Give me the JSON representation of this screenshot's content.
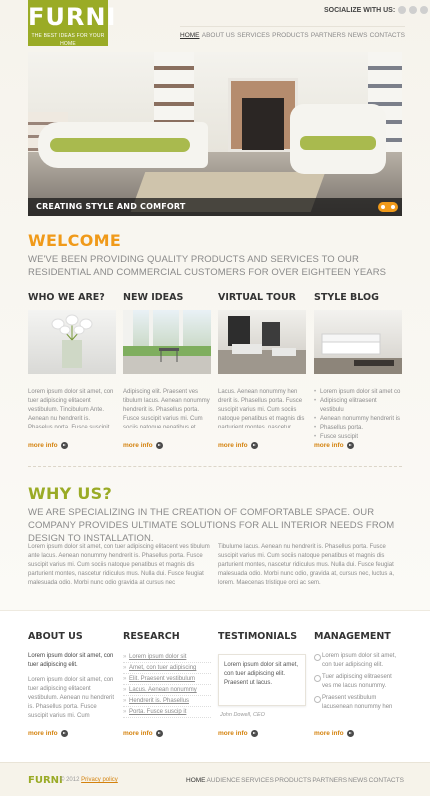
{
  "header": {
    "logo_title": "FURNI",
    "logo_tagline": "THE BEST IDEAS FOR YOUR HOME",
    "social_label": "SOCIALIZE WITH US:",
    "social_icons": [
      "twitter-icon",
      "facebook-icon",
      "rss-icon"
    ],
    "nav": [
      "HOME",
      "ABOUT US",
      "SERVICES",
      "PRODUCTS",
      "PARTNERS",
      "NEWS",
      "CONTACTS"
    ],
    "nav_active_index": 0
  },
  "hero": {
    "caption": "CREATING STYLE AND COMFORT"
  },
  "welcome": {
    "title": "WELCOME",
    "lead": "WE'VE BEEN PROVIDING QUALITY PRODUCTS AND SERVICES TO OUR RESIDENTIAL AND COMMERCIAL CUSTOMERS FOR OVER EIGHTEEN YEARS",
    "columns": [
      {
        "title": "WHO WE ARE?",
        "text": "Lorem ipsum dolor sit amet, con tuer adipiscing elitacent vestibulum. Tincibulum Ante. Aenean nu hendrerit is. Phaselus porta. Fusce suscipit varius mi. Cum",
        "more": "more info"
      },
      {
        "title": "NEW IDEAS",
        "text": "Adipiscing elit. Praesent ves tibulum lacus. Aenean nonummy hendrerit is. Phasellus porta. Fusce suscipit varius mi. Cum sociis natoque penatibus et",
        "more": "more info"
      },
      {
        "title": "VIRTUAL TOUR",
        "text": "Lacus. Aenean nonummy hen drerit is. Phasellus porta. Fusce suscipit varius mi. Cum sociis natoque penatibus et magnis dis parturient montes, nascetur",
        "more": "more info"
      },
      {
        "title": "STYLE BLOG",
        "bullets": [
          "Lorem ipsum dolor sit amet co",
          "Adipiscing elitraesent vestibulu",
          "Aenean nonummy hendrerit is",
          "Phasellus porta.",
          "Fusce suscipit"
        ],
        "more": "more info"
      }
    ]
  },
  "whyus": {
    "title": "WHY US?",
    "lead": "WE ARE SPECIALIZING IN THE CREATION OF COMFORTABLE SPACE. OUR COMPANY PROVIDES ULTIMATE SOLUTIONS FOR ALL INTERIOR NEEDS FROM DESIGN TO INSTALLATION.",
    "para_left": "Lorem ipsum dolor sit amet, con tuer adipiscing elitacent ves tibulum ante lacus. Aenean nonummy hendrerit is. Phasellus porta. Fusce suscipit varius mi. Cum sociis natoque penatibus et magnis dis parturient montes, nascetur ridiculus mus. Nulla dui. Fusce feugiat malesuada odio. Morbi nunc odio gravida at cursus nec",
    "para_right": "Tibulume lacus. Aenean nu hendrerit is. Phasellus porta. Fusce suscipit varius mi. Cum sociis natoque penatibus et magnis dis parturient montes, nascetur ridiculus mus. Nulla dui. Fusce feugiat malesuada odio. Morbi nunc odio, gravida at, cursus nec, luctus a, lorem. Maecenas tristique orci ac sem."
  },
  "widgets": {
    "about": {
      "title": "ABOUT US",
      "intro": "Lorem ipsum dolor sit amet, con tuer adipiscing elit.",
      "text": "Lorem ipsum dolor sit amet, con tuer adipiscing elitacent vestibulum. Aenean nu hendrerit is. Phasellus porta. Fusce suscipit varius mi. Cum",
      "more": "more info"
    },
    "research": {
      "title": "RESEARCH",
      "links": [
        "Lorem ipsum dolor sit",
        "Amet, con tuer adipiscing",
        "Elit. Praesent vestibulum",
        "Lacus. Aenean nonummy",
        "Hendrerit is. Phasellus",
        "Porta. Fusce suscip it"
      ],
      "more": "more info"
    },
    "testimonials": {
      "title": "TESTIMONIALS",
      "quote": "Lorem ipsum dolor sit amet, con tuer adipiscing elit. Praesent ut lacus.",
      "author": "John Dowell, CEO",
      "more": "more info"
    },
    "management": {
      "title": "MANAGEMENT",
      "items": [
        "Lorem ipsum dolor sit amet, con tuer adipiscing elit.",
        "Tuer adipiscing elitraesent ves me lacus nonummy.",
        "Praesent vestibulum lacusenean nonummy hen"
      ],
      "more": "more info"
    }
  },
  "footer": {
    "logo": "FURNI",
    "copyright": "© 2012",
    "privacy": "Privacy policy",
    "nav": [
      "HOME",
      "AUDIENCE",
      "SERVICES",
      "PRODUCTS",
      "PARTNERS",
      "NEWS",
      "CONTACTS"
    ]
  },
  "colors": {
    "brand_green": "#9aab26",
    "accent_orange": "#f09a1a",
    "link_orange": "#d4820d"
  }
}
